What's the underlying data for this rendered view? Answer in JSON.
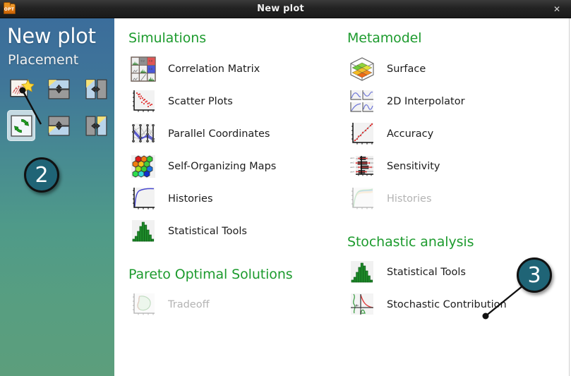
{
  "window": {
    "title": "New plot",
    "app_icon": "opt-folder-icon",
    "app_icon_text": "OPT",
    "close_label": "✕"
  },
  "sidebar": {
    "title": "New plot",
    "subtitle": "Placement",
    "placement_buttons": [
      {
        "name": "placement-new-window",
        "icon": "new-window-icon",
        "selected": false
      },
      {
        "name": "placement-split-horizontal",
        "icon": "split-horizontal-icon",
        "selected": false
      },
      {
        "name": "placement-split-vertical",
        "icon": "split-vertical-icon",
        "selected": false
      },
      {
        "name": "placement-replace",
        "icon": "replace-refresh-icon",
        "selected": true
      },
      {
        "name": "placement-split-horizontal-2",
        "icon": "split-horizontal-alt-icon",
        "selected": false
      },
      {
        "name": "placement-split-vertical-2",
        "icon": "split-vertical-alt-icon",
        "selected": false
      }
    ]
  },
  "sections": {
    "simulations": {
      "heading": "Simulations",
      "items": [
        {
          "label": "Correlation Matrix",
          "icon": "correlation-matrix-icon",
          "enabled": true
        },
        {
          "label": "Scatter Plots",
          "icon": "scatter-plot-icon",
          "enabled": true
        },
        {
          "label": "Parallel Coordinates",
          "icon": "parallel-coordinates-icon",
          "enabled": true
        },
        {
          "label": "Self-Organizing Maps",
          "icon": "self-organizing-map-icon",
          "enabled": true
        },
        {
          "label": "Histories",
          "icon": "histories-icon",
          "enabled": true
        },
        {
          "label": "Statistical Tools",
          "icon": "histogram-icon",
          "enabled": true
        }
      ]
    },
    "pareto": {
      "heading": "Pareto Optimal Solutions",
      "items": [
        {
          "label": "Tradeoff",
          "icon": "tradeoff-icon",
          "enabled": false
        }
      ]
    },
    "metamodel": {
      "heading": "Metamodel",
      "items": [
        {
          "label": "Surface",
          "icon": "surface-3d-icon",
          "enabled": true
        },
        {
          "label": "2D Interpolator",
          "icon": "interpolator-2d-icon",
          "enabled": true
        },
        {
          "label": "Accuracy",
          "icon": "accuracy-icon",
          "enabled": true
        },
        {
          "label": "Sensitivity",
          "icon": "sensitivity-icon",
          "enabled": true
        },
        {
          "label": "Histories",
          "icon": "histories-band-icon",
          "enabled": false
        }
      ]
    },
    "stochastic": {
      "heading": "Stochastic analysis",
      "items": [
        {
          "label": "Statistical Tools",
          "icon": "histogram-icon",
          "enabled": true
        },
        {
          "label": "Stochastic Contribution",
          "icon": "stochastic-contribution-icon",
          "enabled": true
        }
      ]
    }
  },
  "callouts": [
    {
      "label": "2",
      "target": "placement-replace"
    },
    {
      "label": "3",
      "target": "stochastic-statistical-tools"
    }
  ],
  "colors": {
    "heading_green": "#1d9b2e",
    "callout_fill": "#1f6476",
    "sidebar_top": "#3b6d9b",
    "sidebar_bottom": "#5c9e7c",
    "titlebar": "#232323",
    "disabled_text": "#b3b3b3"
  }
}
